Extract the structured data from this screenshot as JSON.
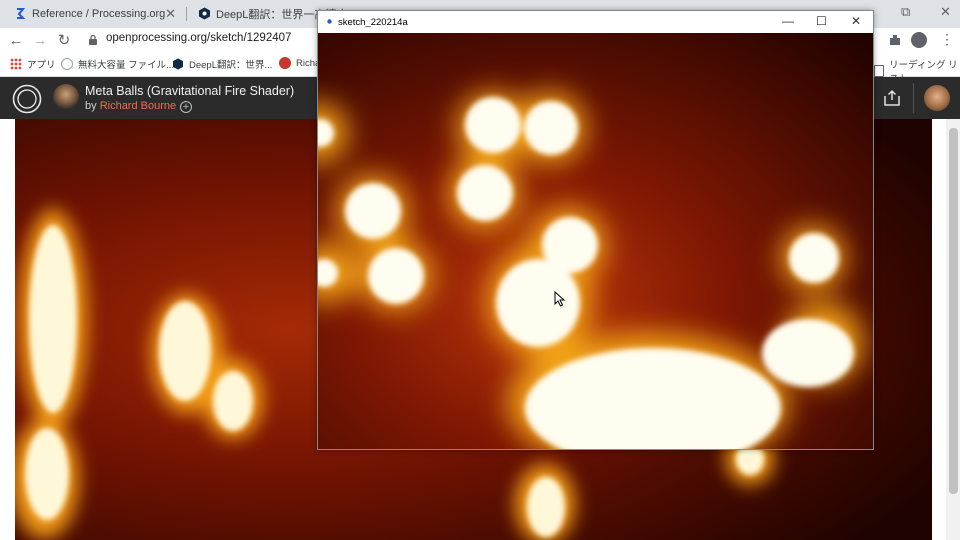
{
  "browser": {
    "tabs": [
      {
        "title": "Reference / Processing.org"
      },
      {
        "title": "DeepL翻訳：世界一高精度..."
      }
    ],
    "url": "openprocessing.org/sketch/1292407",
    "bookmarks": [
      {
        "label": "アプリ"
      },
      {
        "label": "無料大容量 ファイル..."
      },
      {
        "label": "DeepL翻訳：世界..."
      },
      {
        "label": "Richa"
      },
      {
        "label": "リーディング リスト"
      }
    ]
  },
  "header": {
    "title": "Meta Balls (Gravitational Fire Shader)",
    "by_label": "by",
    "author": "Richard Bourne",
    "follow_symbol": "+"
  },
  "popup": {
    "title": "sketch_220214a",
    "minimize": "—",
    "maximize": "☐",
    "close": "✕"
  },
  "icons": {
    "back": "←",
    "forward": "→",
    "reload": "↻",
    "tab_close": "✕"
  },
  "colors": {
    "fire_dark": "#3a0400",
    "fire_red": "#8a1a02",
    "fire_orange": "#e87a0a",
    "fire_yellow": "#ffd84a",
    "header_bg": "#2b2b2b",
    "author_link": "#f06c52"
  }
}
